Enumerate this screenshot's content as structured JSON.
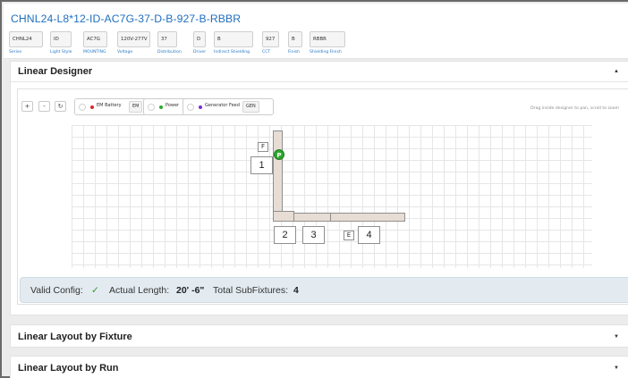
{
  "sku": "CHNL24-L8*12-ID-AC7G-37-D-B-927-B-RBBR",
  "fields": [
    {
      "value": "CHNL24",
      "label": "Series"
    },
    {
      "value": "ID",
      "label": "Light Style"
    },
    {
      "value": "AC7G",
      "label": "MOUNTING"
    },
    {
      "value": "120V-277V",
      "label": "Voltage"
    },
    {
      "value": "37",
      "label": "Distribution"
    },
    {
      "value": "D",
      "label": "Driver"
    },
    {
      "value": "B",
      "label": "Indirect Shielding"
    },
    {
      "value": "927",
      "label": "CCT"
    },
    {
      "value": "B",
      "label": "Finish"
    },
    {
      "value": "RBBR",
      "label": "Shielding Finish"
    }
  ],
  "designer": {
    "title": "Linear Designer",
    "expanded_caret": "▲",
    "tools": {
      "zoom_in": "+",
      "zoom_out": "-",
      "reset": "↻"
    },
    "legend": {
      "em_battery": {
        "label": "EM Battery",
        "tag": "EM",
        "color": "#d62828"
      },
      "power": {
        "label": "Power",
        "color": "#2ea82e"
      },
      "generator_feed": {
        "label": "Generator Feed",
        "tag": "GEN",
        "color": "#7b2cd6"
      }
    },
    "hint": "Drag inside designer to pan, scroll to zoom",
    "markers": {
      "f_box": "F",
      "e_box": "E",
      "power": "P"
    },
    "subfixtures": [
      "1",
      "2",
      "3",
      "4"
    ],
    "status": {
      "valid_label": "Valid Config:",
      "valid_mark": "✓",
      "length_label": "Actual Length:",
      "length_value": "20' -6\"",
      "total_label": "Total SubFixtures:",
      "total_value": "4"
    }
  },
  "sections": {
    "by_fixture": {
      "title": "Linear Layout by Fixture",
      "caret": "▼"
    },
    "by_run": {
      "title": "Linear Layout by Run",
      "caret": "▼"
    }
  }
}
